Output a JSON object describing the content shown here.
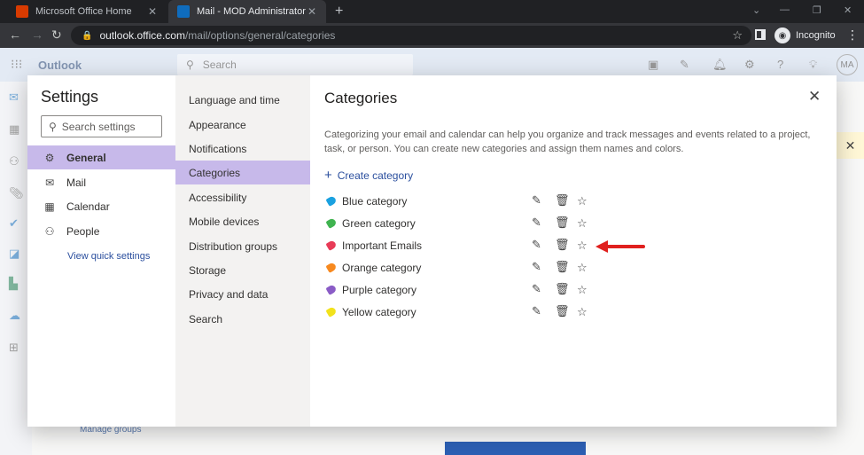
{
  "browser": {
    "tabs": [
      {
        "title": "Microsoft Office Home",
        "icon": "office-icon",
        "color": "#d83b01"
      },
      {
        "title": "Mail - MOD Administrator - Outl",
        "icon": "outlook-icon",
        "color": "#0f6cbd"
      }
    ],
    "url_host": "outlook.office.com",
    "url_path": "/mail/options/general/categories",
    "incognito_label": "Incognito"
  },
  "app": {
    "brand": "Outlook",
    "search_placeholder": "Search",
    "avatar_initials": "MA",
    "bg_manage_groups": "Manage groups"
  },
  "settings": {
    "title": "Settings",
    "search_placeholder": "Search settings",
    "top_categories": [
      {
        "label": "General",
        "icon": "gear-icon",
        "active": true
      },
      {
        "label": "Mail",
        "icon": "mail-icon",
        "active": false
      },
      {
        "label": "Calendar",
        "icon": "calendar-icon",
        "active": false
      },
      {
        "label": "People",
        "icon": "people-icon",
        "active": false
      }
    ],
    "quick_settings": "View quick settings",
    "sub_categories": [
      {
        "label": "Language and time"
      },
      {
        "label": "Appearance"
      },
      {
        "label": "Notifications"
      },
      {
        "label": "Categories",
        "active": true
      },
      {
        "label": "Accessibility"
      },
      {
        "label": "Mobile devices"
      },
      {
        "label": "Distribution groups"
      },
      {
        "label": "Storage"
      },
      {
        "label": "Privacy and data"
      },
      {
        "label": "Search"
      }
    ]
  },
  "pane": {
    "title": "Categories",
    "description": "Categorizing your email and calendar can help you organize and track messages and events related to a project, task, or person. You can create new categories and assign them names and colors.",
    "create_label": "Create category",
    "categories": [
      {
        "name": "Blue category",
        "color": "#1aa1e0"
      },
      {
        "name": "Green category",
        "color": "#3fb34f"
      },
      {
        "name": "Important Emails",
        "color": "#e83b57"
      },
      {
        "name": "Orange category",
        "color": "#f7891f"
      },
      {
        "name": "Purple category",
        "color": "#8a5cc6"
      },
      {
        "name": "Yellow category",
        "color": "#f2e21c"
      }
    ]
  },
  "colors": {
    "accent_selected": "#c7b9ea",
    "link": "#2b4f9e",
    "annotation_arrow": "#e0201e"
  }
}
